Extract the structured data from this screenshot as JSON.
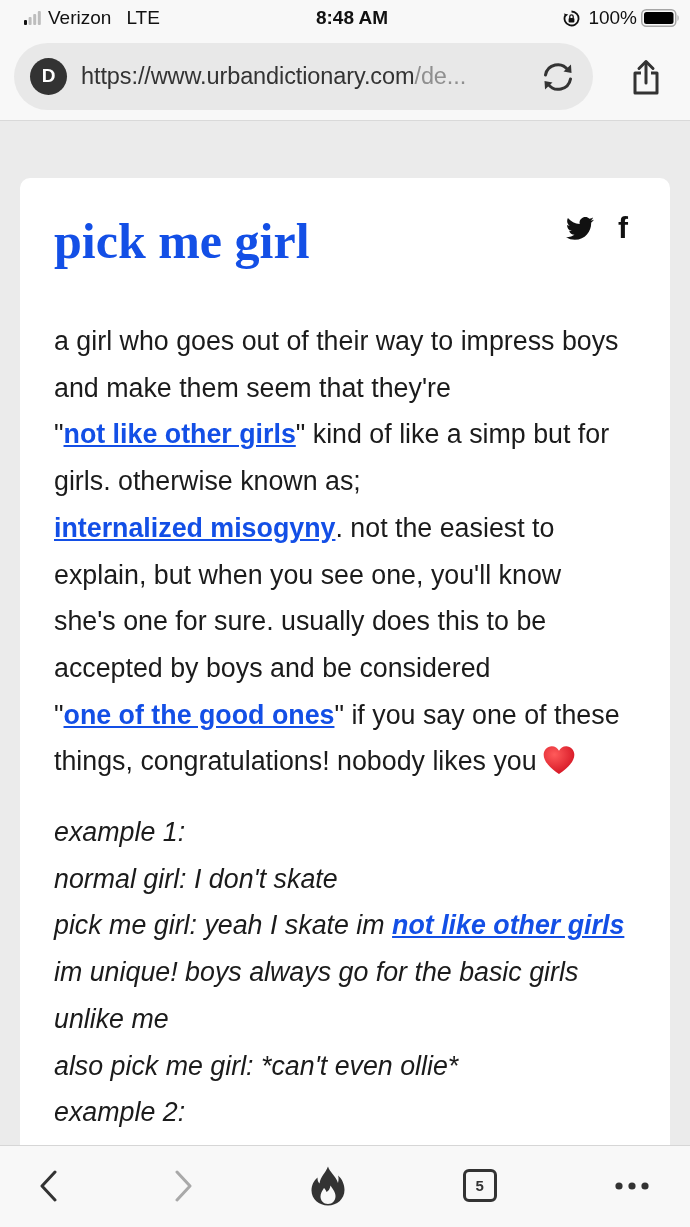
{
  "status_bar": {
    "carrier": "Verizon",
    "network": "LTE",
    "time": "8:48 AM",
    "battery": "100%"
  },
  "address_bar": {
    "site_letter": "D",
    "url": "https://www.urbandictionary.com",
    "url_tail": "/de..."
  },
  "definition": {
    "word": "pick me girl",
    "share_letter": "f",
    "meaning": [
      {
        "kind": "text",
        "text": "a girl who goes out of their way to impress boys and make them seem that they're \""
      },
      {
        "kind": "link",
        "text": "not like other girls"
      },
      {
        "kind": "text",
        "text": "\" kind of like a simp but for girls. otherwise known as; "
      },
      {
        "kind": "link",
        "text": "internalized misogyny"
      },
      {
        "kind": "text",
        "text": ". not the easiest to explain, but when you see one, you'll know she's one for sure. usually does this to be accepted by boys and be considered \""
      },
      {
        "kind": "link",
        "text": "one of the good ones"
      },
      {
        "kind": "text",
        "text": "\" if you say one of these things, congratulations! nobody likes you"
      }
    ],
    "example": [
      {
        "parts": [
          {
            "kind": "text",
            "text": "example 1:"
          }
        ]
      },
      {
        "parts": [
          {
            "kind": "text",
            "text": "normal girl: I don't skate"
          }
        ]
      },
      {
        "parts": [
          {
            "kind": "text",
            "text": "pick me girl: yeah I skate im "
          },
          {
            "kind": "link",
            "text": "not like other girls"
          },
          {
            "kind": "text",
            "text": " im unique! boys always go for the basic girls unlike me"
          }
        ]
      },
      {
        "parts": [
          {
            "kind": "text",
            "text": "also pick me girl: *can't even ollie*"
          }
        ]
      },
      {
        "parts": [
          {
            "kind": "text",
            "text": "example 2:"
          }
        ]
      }
    ]
  },
  "toolbar": {
    "back": {
      "disabled": false
    },
    "forward": {
      "disabled": true
    },
    "tab_count": "5"
  }
}
